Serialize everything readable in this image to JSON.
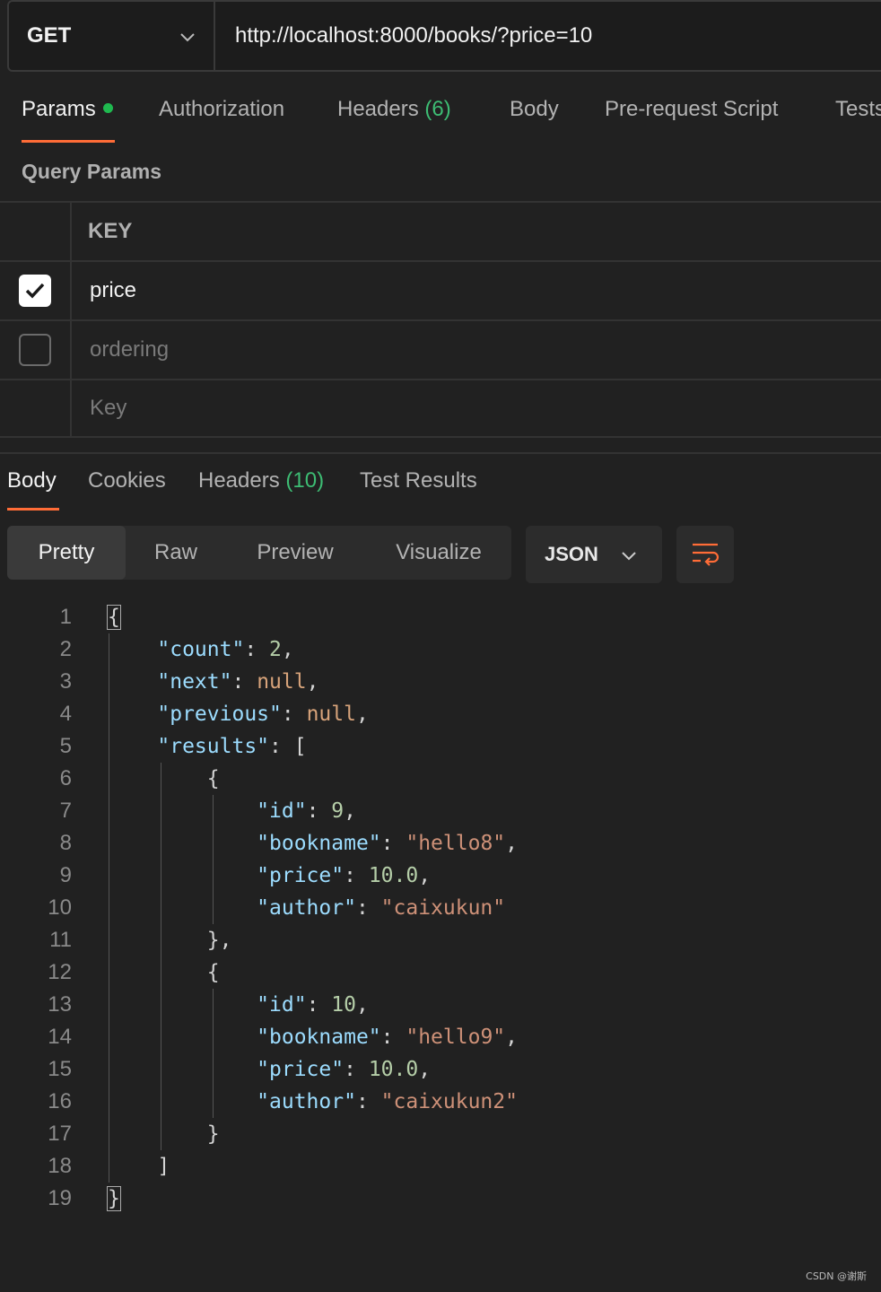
{
  "request": {
    "method": "GET",
    "url": "http://localhost:8000/books/?price=10"
  },
  "request_tabs": {
    "params": "Params",
    "authorization": "Authorization",
    "headers": "Headers",
    "headers_count": "(6)",
    "body": "Body",
    "prerequest": "Pre-request Script",
    "tests": "Tests"
  },
  "query_params": {
    "title": "Query Params",
    "key_header": "KEY",
    "rows": [
      {
        "key": "price",
        "checked": true
      },
      {
        "key": "ordering",
        "checked": false
      }
    ],
    "new_key_placeholder": "Key"
  },
  "response_tabs": {
    "body": "Body",
    "cookies": "Cookies",
    "headers": "Headers",
    "headers_count": "(10)",
    "test_results": "Test Results"
  },
  "view_modes": {
    "pretty": "Pretty",
    "raw": "Raw",
    "preview": "Preview",
    "visualize": "Visualize"
  },
  "format": "JSON",
  "code_lines": [
    "{",
    "    \"count\": 2,",
    "    \"next\": null,",
    "    \"previous\": null,",
    "    \"results\": [",
    "        {",
    "            \"id\": 9,",
    "            \"bookname\": \"hello8\",",
    "            \"price\": 10.0,",
    "            \"author\": \"caixukun\"",
    "        },",
    "        {",
    "            \"id\": 10,",
    "            \"bookname\": \"hello9\",",
    "            \"price\": 10.0,",
    "            \"author\": \"caixukun2\"",
    "        }",
    "    ]",
    "}"
  ],
  "line_numbers": [
    "1",
    "2",
    "3",
    "4",
    "5",
    "6",
    "7",
    "8",
    "9",
    "10",
    "11",
    "12",
    "13",
    "14",
    "15",
    "16",
    "17",
    "18",
    "19"
  ],
  "watermark": "CSDN @谢斯",
  "colors": {
    "accent": "#ff6c37",
    "success": "#1fb94f",
    "json_key": "#9cdcfe",
    "json_string": "#ce9178",
    "json_number": "#b5cea8"
  }
}
